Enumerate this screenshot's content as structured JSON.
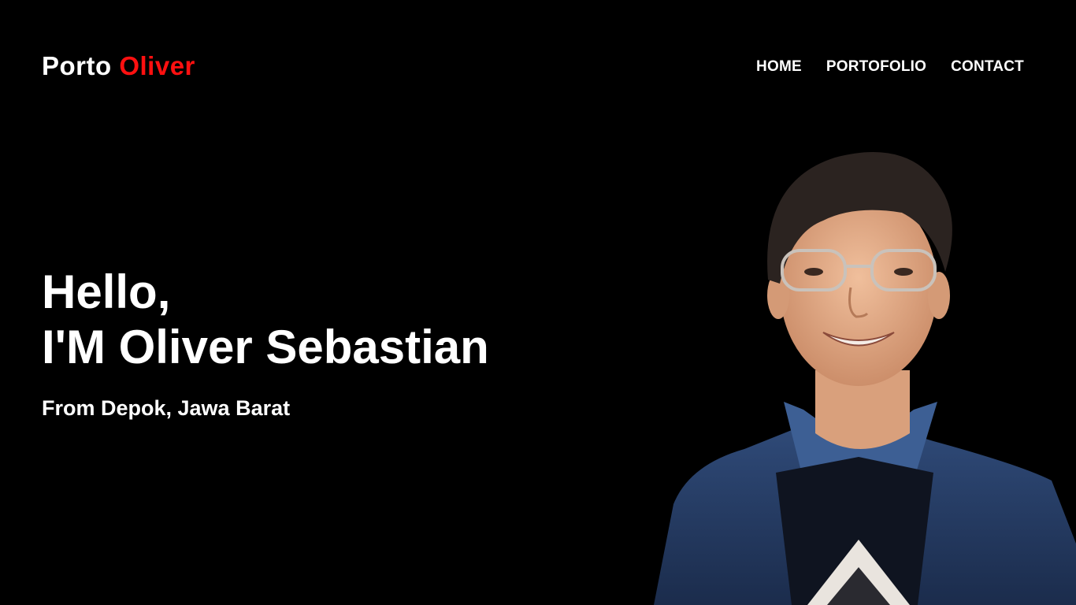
{
  "header": {
    "logo": {
      "first": "Porto",
      "second": "Oliver"
    },
    "nav": [
      {
        "label": "HOME"
      },
      {
        "label": "PORTOFOLIO"
      },
      {
        "label": "CONTACT"
      }
    ]
  },
  "hero": {
    "greeting": "Hello,",
    "intro": "I'M Oliver Sebastian",
    "location": "From Depok, Jawa Barat"
  },
  "colors": {
    "background": "#000000",
    "text": "#ffffff",
    "accent": "#ff1010"
  }
}
